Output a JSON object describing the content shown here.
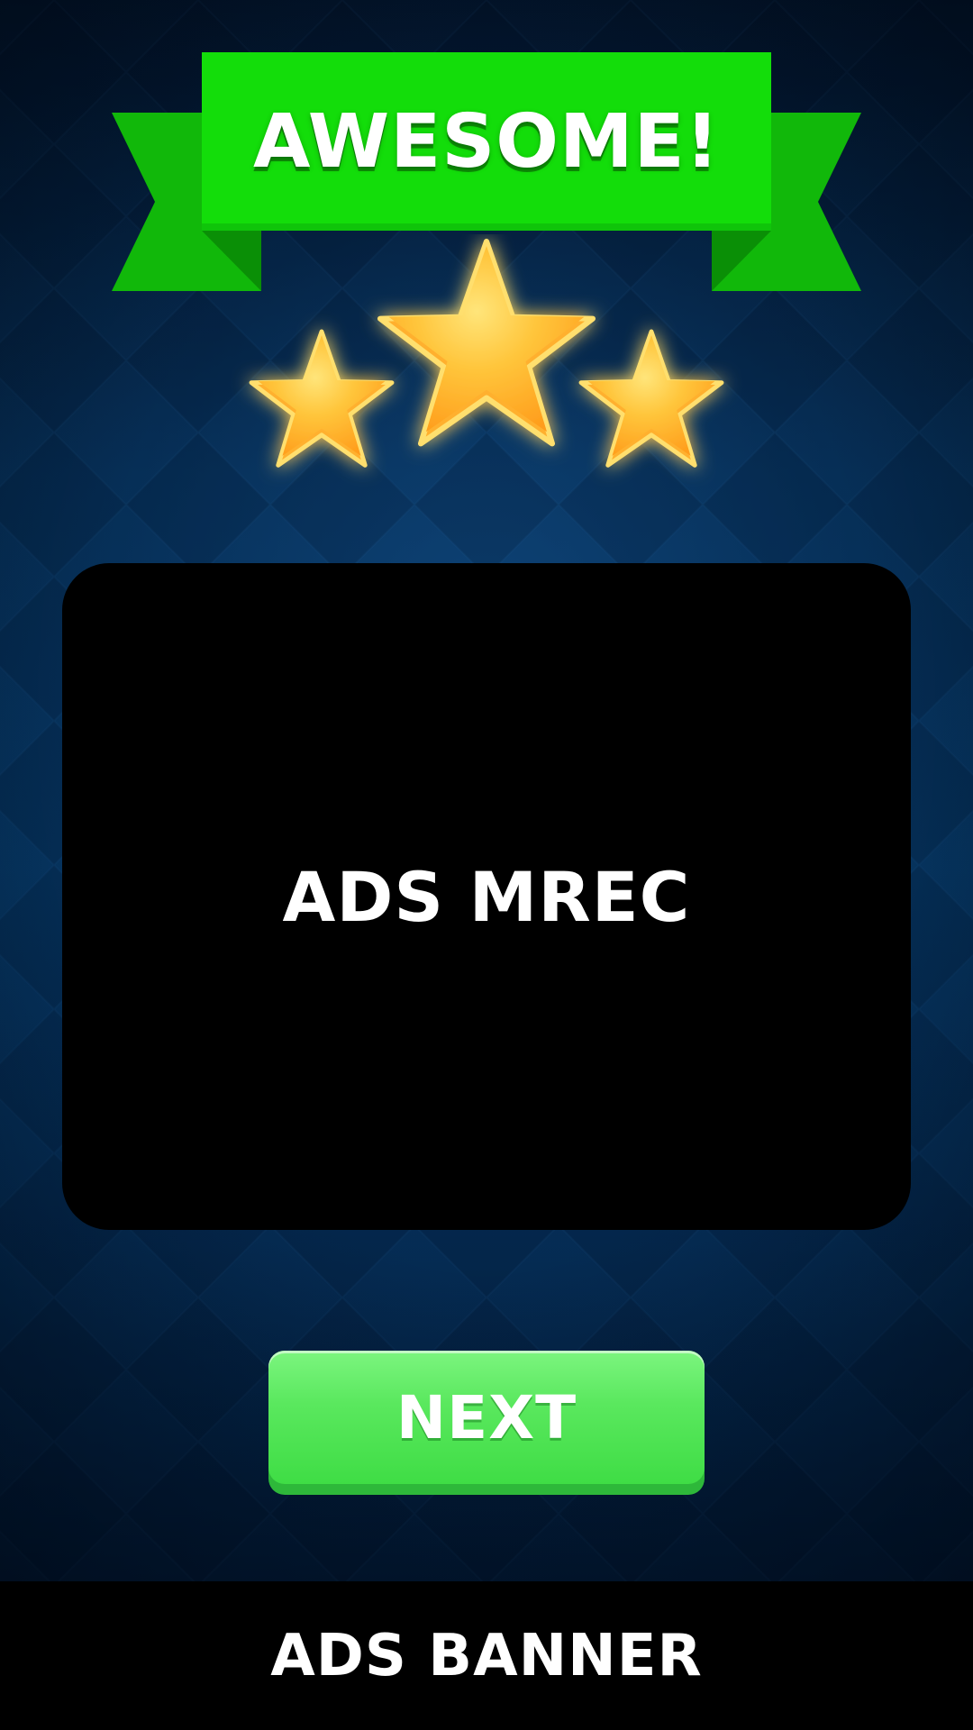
{
  "header": {
    "title": "AWESOME!"
  },
  "rating": {
    "stars_earned": 3,
    "stars_total": 3
  },
  "ad_mrec": {
    "label": "ADS MREC"
  },
  "actions": {
    "next_label": "NEXT"
  },
  "ad_banner": {
    "label": "ADS BANNER"
  },
  "colors": {
    "ribbon_green": "#13dd0a",
    "ribbon_dark": "#0fb70a",
    "button_green": "#5ae85e",
    "star_gold": "#ffc53b",
    "background": "#063a68"
  },
  "icons": [
    "star-icon"
  ]
}
